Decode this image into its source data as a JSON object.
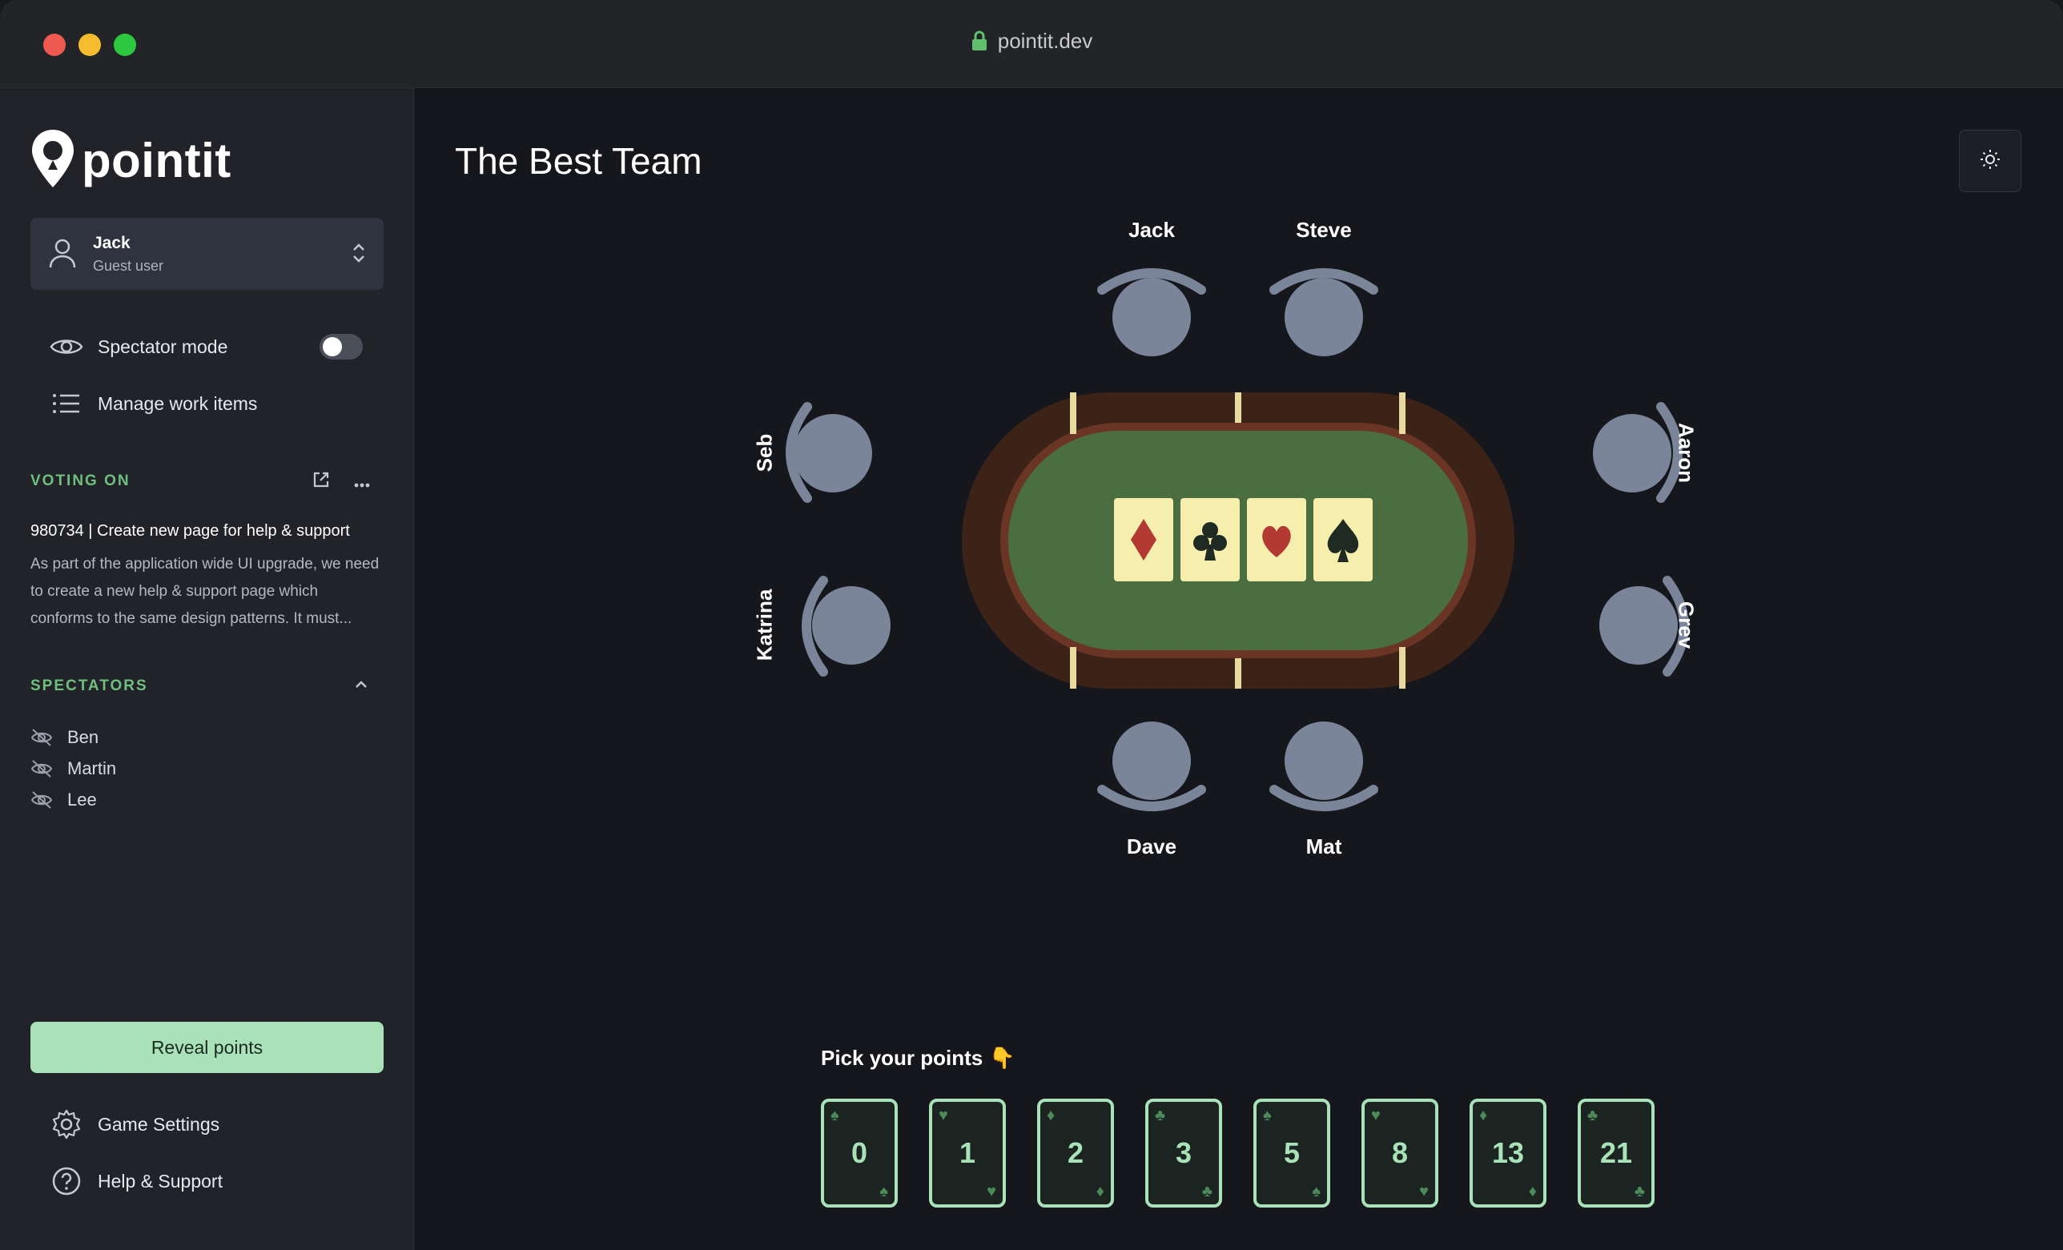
{
  "window": {
    "url": "pointit.dev"
  },
  "sidebar": {
    "logo_text": "pointit",
    "user": {
      "name": "Jack",
      "role": "Guest user"
    },
    "spectator_mode": {
      "label": "Spectator mode",
      "enabled": false
    },
    "manage_work_items": "Manage work items",
    "voting_on": {
      "title": "VOTING ON",
      "item_title": "980734 | Create new page for help & support",
      "item_desc": "As part of the application wide UI upgrade, we need to create a new help & support page which conforms to the same design patterns. It must..."
    },
    "spectators": {
      "title": "SPECTATORS",
      "names": [
        "Ben",
        "Martin",
        "Lee"
      ]
    },
    "reveal_button": "Reveal points",
    "game_settings": "Game Settings",
    "help_support": "Help & Support"
  },
  "main": {
    "title": "The Best Team",
    "players": {
      "top": [
        "Jack",
        "Steve"
      ],
      "left": [
        "Seb",
        "Katrina"
      ],
      "right": [
        "Aaron",
        "Grev"
      ],
      "bottom": [
        "Dave",
        "Mat"
      ]
    },
    "table_cards": [
      "diamond",
      "club",
      "heart",
      "spade"
    ],
    "pick_label": "Pick your points",
    "pick_emoji": "👇",
    "point_cards": [
      {
        "value": "0",
        "suit": "♠"
      },
      {
        "value": "1",
        "suit": "♥"
      },
      {
        "value": "2",
        "suit": "♦"
      },
      {
        "value": "3",
        "suit": "♣"
      },
      {
        "value": "5",
        "suit": "♠"
      },
      {
        "value": "8",
        "suit": "♥"
      },
      {
        "value": "13",
        "suit": "♦"
      },
      {
        "value": "21",
        "suit": "♣"
      }
    ]
  },
  "colors": {
    "accent": "#a9e2b8",
    "section_green": "#6fbf7e",
    "felt": "#4a6e3f",
    "table_wood": "#3d2218",
    "seat": "#7a8599"
  }
}
